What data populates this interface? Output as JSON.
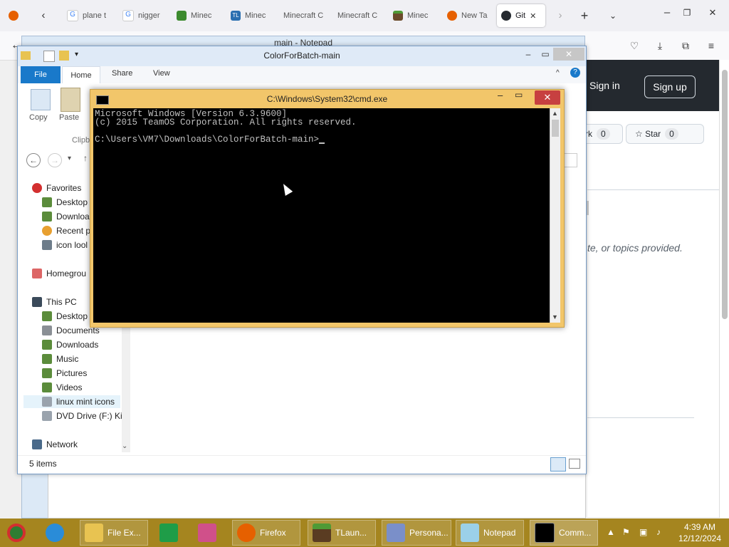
{
  "browser": {
    "tabs": [
      {
        "label": "plane t",
        "icon": "google-icon"
      },
      {
        "label": "nigger",
        "icon": "google-icon"
      },
      {
        "label": "Minec",
        "icon": "minecraft-creeper-icon"
      },
      {
        "label": "Minec",
        "icon": "tlauncher-icon"
      },
      {
        "label": "Minecraft C",
        "icon": "blank-page-icon"
      },
      {
        "label": "Minecraft C",
        "icon": "blank-page-icon"
      },
      {
        "label": "Minec",
        "icon": "minecraft-grass-block-icon"
      },
      {
        "label": "New Ta",
        "icon": "firefox-icon"
      },
      {
        "label": "Git",
        "icon": "github-icon",
        "active": true
      }
    ]
  },
  "github": {
    "sign_in": "Sign in",
    "sign_up": "Sign up",
    "fork_label": "rk",
    "fork_count": "0",
    "star_label": "Star",
    "star_count": "0",
    "empty_text": "te, or topics provided."
  },
  "notepad": {
    "title": "main - Notepad"
  },
  "explorer": {
    "title": "ColorForBatch-main",
    "ribbon_tabs": {
      "file": "File",
      "home": "Home",
      "share": "Share",
      "view": "View"
    },
    "ribbon": {
      "copy": "Copy",
      "paste": "Paste",
      "clipboard": "Clipb"
    },
    "tree": {
      "favorites": "Favorites",
      "desktop": "Desktop",
      "downloads": "Downloa",
      "recent": "Recent p",
      "icon_look": "icon lool",
      "homegroup": "Homegrou",
      "this_pc": "This PC",
      "pc_desktop": "Desktop",
      "documents": "Documents",
      "pc_downloads": "Downloads",
      "music": "Music",
      "pictures": "Pictures",
      "videos": "Videos",
      "linux_mint_icons": "linux mint icons",
      "dvd_drive": "DVD Drive (F:) Kic",
      "network": "Network"
    },
    "status": "5 items"
  },
  "cmd": {
    "title": "C:\\Windows\\System32\\cmd.exe",
    "lines": {
      "l1": "Microsoft Windows [Version 6.3.9600]",
      "l2": "(c) 2015 TeamOS Corporation. All rights reserved.",
      "prompt": "C:\\Users\\VM7\\Downloads\\ColorForBatch-main>"
    }
  },
  "taskbar": {
    "items": {
      "file_explorer": "File Ex...",
      "firefox": "Firefox",
      "tlauncher": "TLaun...",
      "personalize": "Persona...",
      "notepad": "Notepad",
      "command": "Comm..."
    },
    "clock": {
      "time": "4:39 AM",
      "date": "12/12/2024"
    }
  },
  "colors": {
    "taskbar": "#a5851f",
    "cmd_frame": "#f2c66a",
    "explorer_file_tab": "#1979ca",
    "cmd_close": "#c74040"
  }
}
